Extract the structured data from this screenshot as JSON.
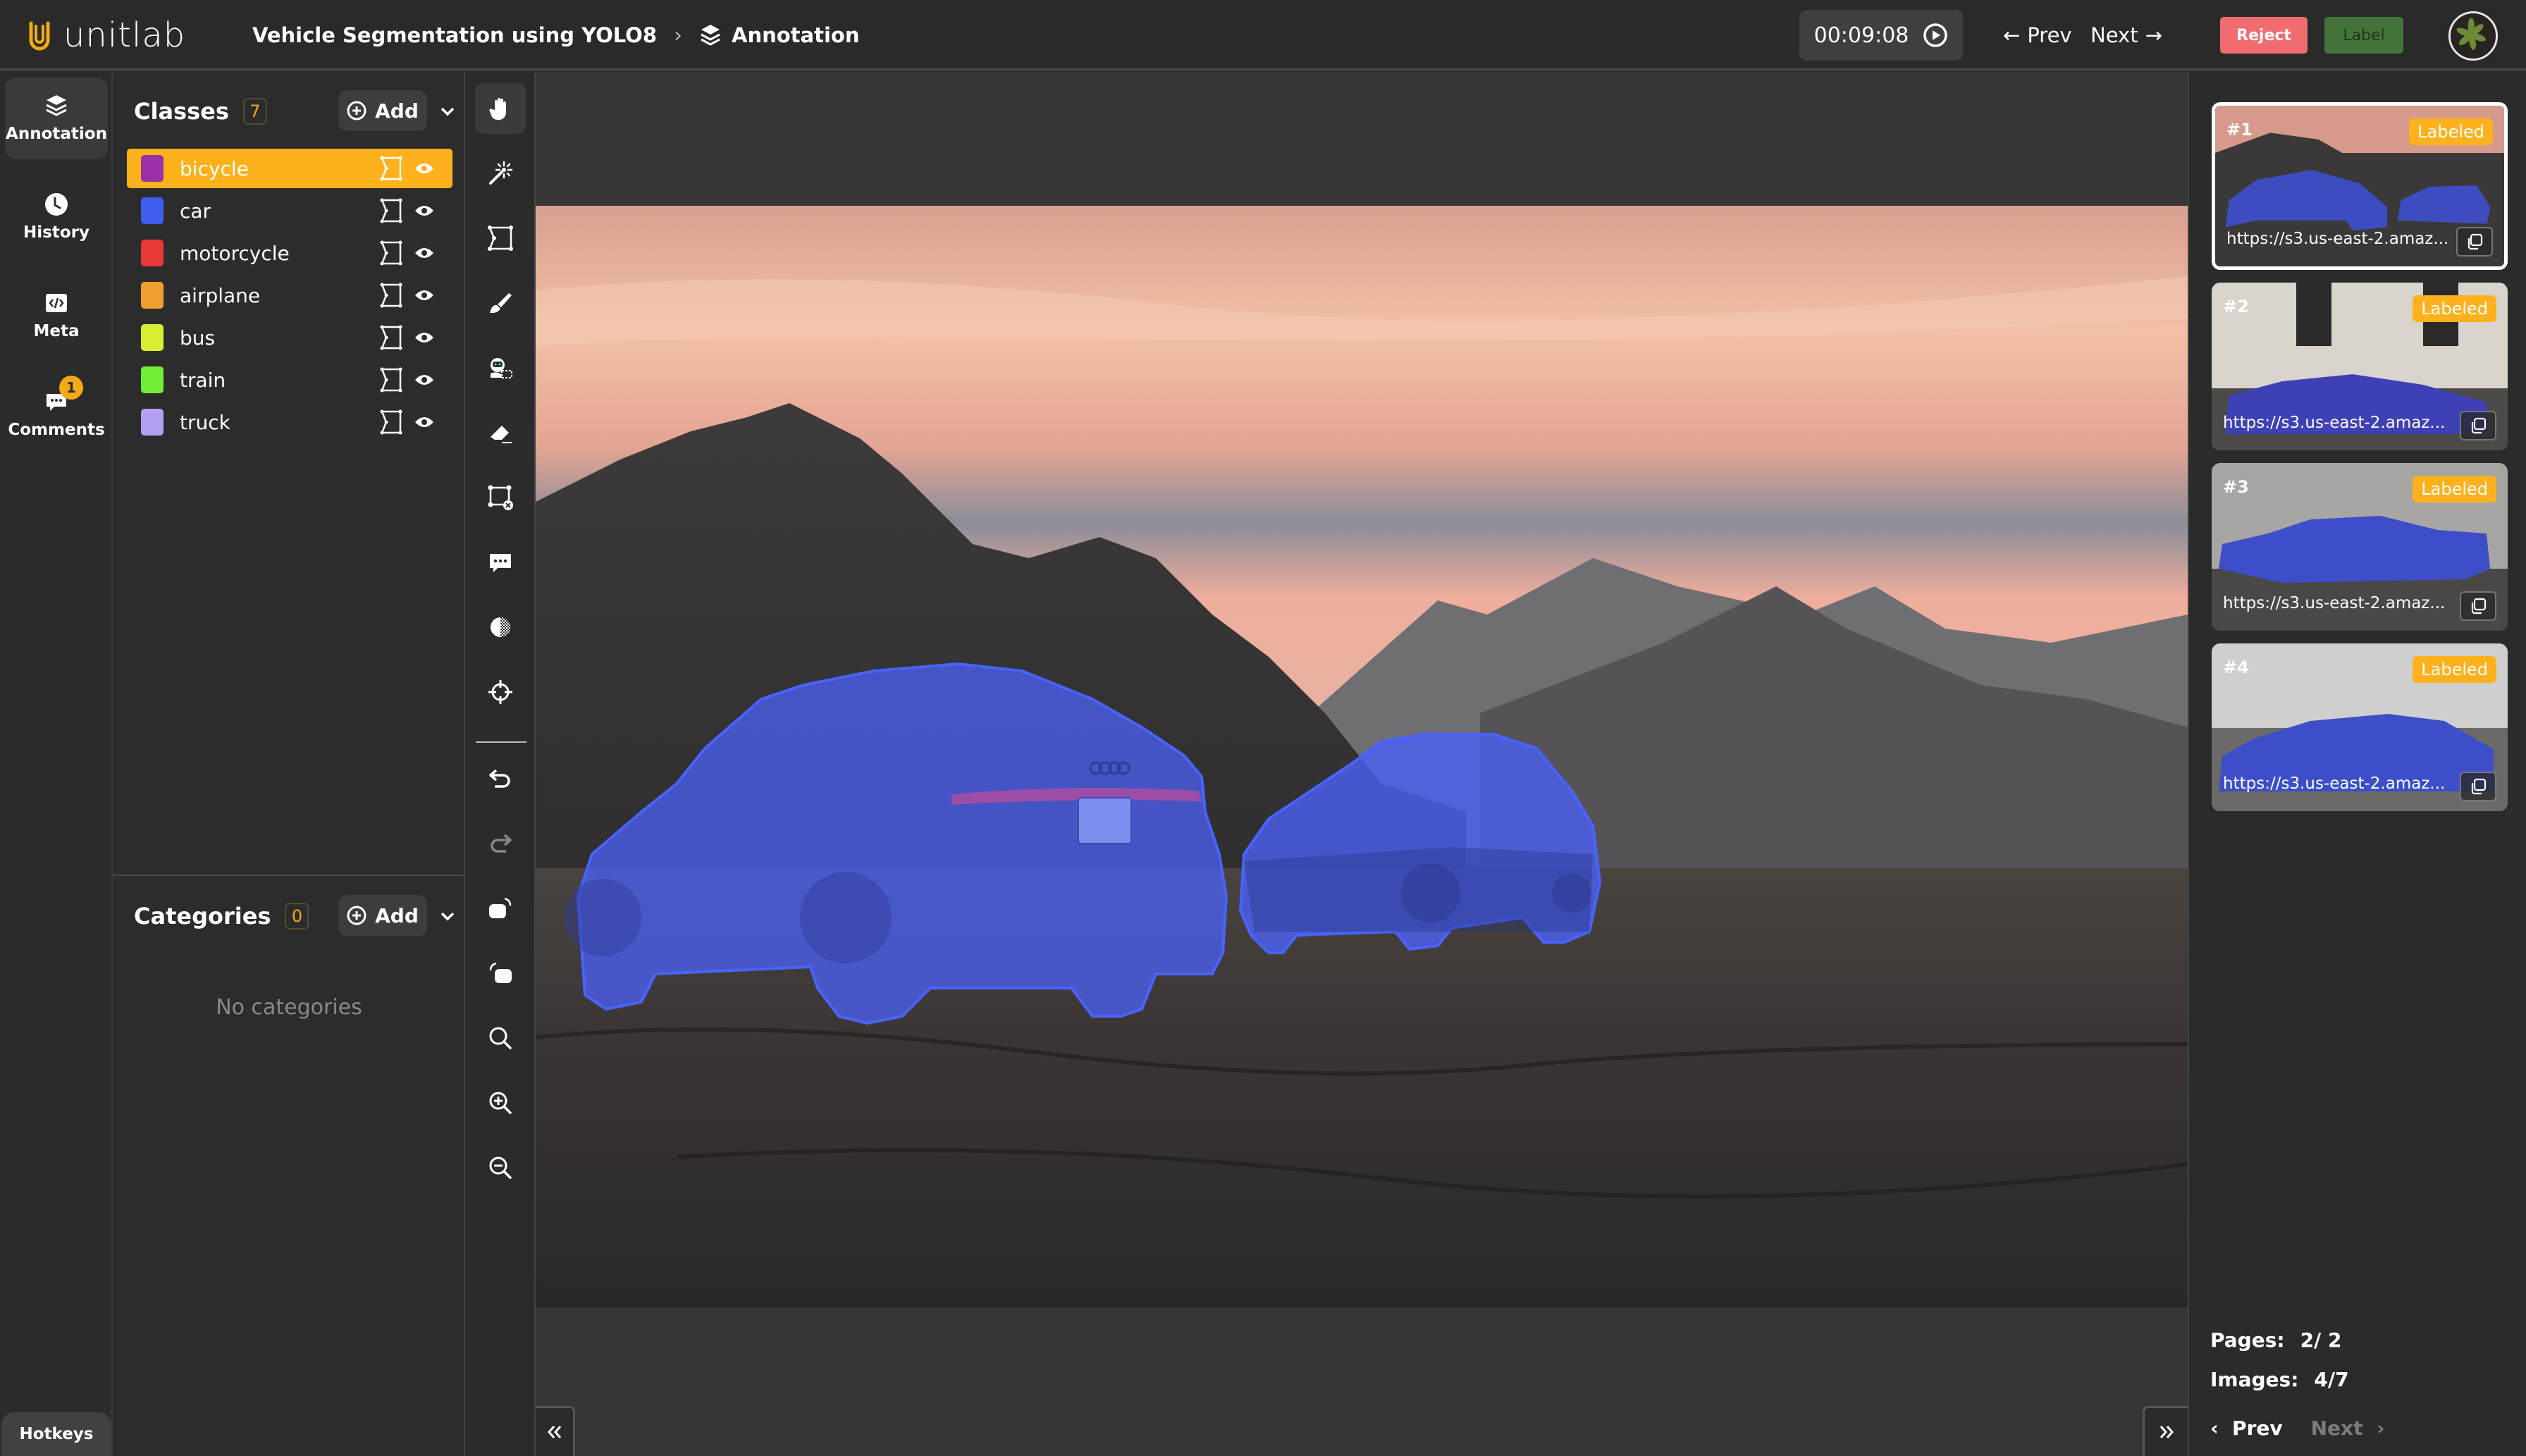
{
  "header": {
    "logo_text": "unitlab",
    "project_title": "Vehicle Segmentation using YOLO8",
    "breadcrumb_current": "Annotation",
    "timer": "00:09:08",
    "prev_label": "Prev",
    "next_label": "Next",
    "reject_label": "Reject",
    "label_label": "Label"
  },
  "nav": {
    "items": [
      {
        "label": "Annotation",
        "icon": "layers-icon",
        "active": true
      },
      {
        "label": "History",
        "icon": "clock-icon"
      },
      {
        "label": "Meta",
        "icon": "code-icon"
      },
      {
        "label": "Comments",
        "icon": "comment-icon",
        "badge": "1"
      }
    ],
    "hotkeys_label": "Hotkeys"
  },
  "classes": {
    "title": "Classes",
    "count": "7",
    "add_label": "Add",
    "items": [
      {
        "name": "bicycle",
        "color": "#9b30a8",
        "selected": true
      },
      {
        "name": "car",
        "color": "#3f5ef0"
      },
      {
        "name": "motorcycle",
        "color": "#e83838"
      },
      {
        "name": "airplane",
        "color": "#f0a030"
      },
      {
        "name": "bus",
        "color": "#d8ee30"
      },
      {
        "name": "train",
        "color": "#72ee38"
      },
      {
        "name": "truck",
        "color": "#b4a0f0"
      }
    ]
  },
  "categories": {
    "title": "Categories",
    "count": "0",
    "add_label": "Add",
    "empty_text": "No categories"
  },
  "tools": [
    "hand-icon",
    "magic-wand-icon",
    "polygon-icon",
    "brush-icon",
    "ai-robot-icon",
    "eraser-icon",
    "polygon-delete-icon",
    "comment-icon",
    "contrast-icon",
    "crosshair-icon",
    "undo-icon",
    "redo-icon",
    "rotate-right-icon",
    "rotate-left-icon",
    "zoom-fit-icon",
    "zoom-in-icon",
    "zoom-out-icon"
  ],
  "accent_color": "#fcb11d",
  "mask_color": "#4a5ff0",
  "thumbnails": [
    {
      "num": "#1",
      "status": "Labeled",
      "url": "https://s3.us-east-2.amaz...",
      "current": true
    },
    {
      "num": "#2",
      "status": "Labeled",
      "url": "https://s3.us-east-2.amaz..."
    },
    {
      "num": "#3",
      "status": "Labeled",
      "url": "https://s3.us-east-2.amaz..."
    },
    {
      "num": "#4",
      "status": "Labeled",
      "url": "https://s3.us-east-2.amaz..."
    }
  ],
  "pagination": {
    "pages_label": "Pages:",
    "pages_value": "2/ 2",
    "images_label": "Images:",
    "images_value": "4/7",
    "prev_label": "Prev",
    "next_label": "Next"
  }
}
